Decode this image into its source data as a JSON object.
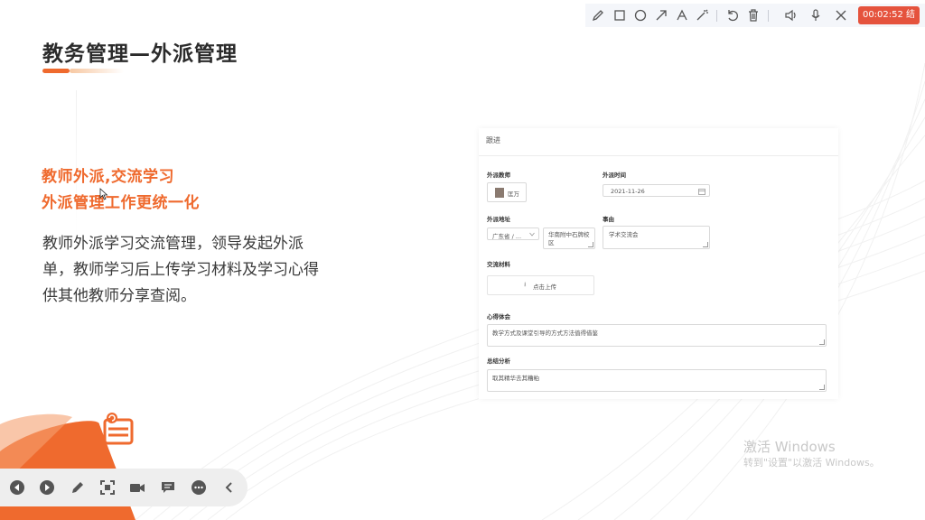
{
  "slide": {
    "title": "教务管理—外派管理",
    "headline_1": "教师外派,交流学习",
    "headline_2": "外派管理工作更统一化",
    "description": "教师外派学习交流管理，领导发起外派单，教师学习后上传学习材料及学习心得供其他教师分享查阅。"
  },
  "toolbar": {
    "icons": [
      "pen-icon",
      "rectangle-icon",
      "circle-icon",
      "arrow-icon",
      "text-icon",
      "magic-wand-icon",
      "undo-icon",
      "trash-icon",
      "speaker-icon",
      "microphone-icon",
      "close-icon"
    ],
    "end_label": "00:02:52 结束"
  },
  "form": {
    "header": "跟进",
    "teacher_label": "外派教师",
    "teacher_name": "匡万",
    "time_label": "外派时间",
    "time_value": "2021-11-26",
    "address_label": "外派地址",
    "province_value": "广东省 / ...",
    "address_detail": "华南附中石牌校区",
    "matter_label": "事由",
    "matter_value": "学术交流会",
    "material_label": "交流材料",
    "upload_label": "点击上传",
    "experience_label": "心得体会",
    "experience_value": "教学方式及课堂引导的方式方法值得借鉴",
    "summary_label": "总结分析",
    "summary_value": "取其精华去其糟粕"
  },
  "controls": {
    "icons": [
      "previous-icon",
      "next-icon",
      "pen-icon",
      "screen-select-icon",
      "camera-icon",
      "comment-icon",
      "more-icon",
      "collapse-icon"
    ]
  },
  "watermark": {
    "line1": "激活 Windows",
    "line2": "转到\"设置\"以激活 Windows。"
  },
  "colors": {
    "accent": "#ef6a2e",
    "end_button": "#e5533d"
  }
}
